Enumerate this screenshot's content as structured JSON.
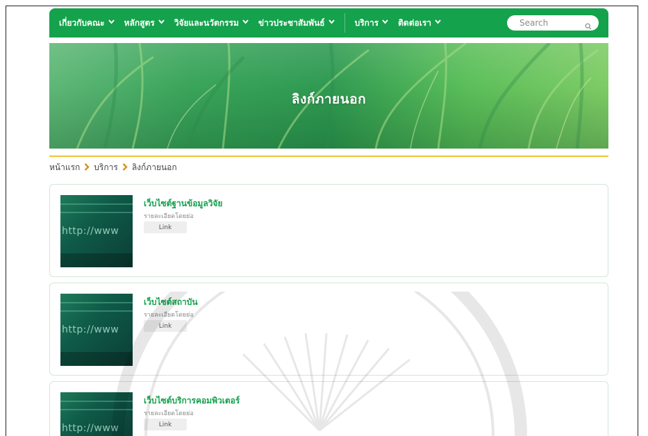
{
  "nav": {
    "items": [
      {
        "label": "เกี่ยวกับคณะ"
      },
      {
        "label": "หลักสูตร"
      },
      {
        "label": "วิจัยและนวัตกรรม"
      },
      {
        "label": "ข่าวประชาสัมพันธ์"
      },
      {
        "label": "บริการ"
      },
      {
        "label": "ติดต่อเรา"
      }
    ],
    "search_placeholder": "Search"
  },
  "banner": {
    "title": "ลิงก์ภายนอก"
  },
  "breadcrumb": {
    "items": [
      "หน้าแรก",
      "บริการ",
      "ลิงก์ภายนอก"
    ]
  },
  "links": [
    {
      "title": "เว็บไซต์ฐานข้อมูลวิจัย",
      "desc": "รายละเอียดโดยย่อ",
      "button": "Link",
      "thumb_text": "http://www"
    },
    {
      "title": "เว็บไซต์สถาบัน",
      "desc": "รายละเอียดโดยย่อ",
      "button": "Link",
      "thumb_text": "http://www"
    },
    {
      "title": "เว็บไซต์บริการคอมพิวเตอร์",
      "desc": "รายละเอียดโดยย่อ",
      "button": "Link",
      "thumb_text": "http://www"
    }
  ],
  "colors": {
    "brand_green": "#14a24c",
    "accent_gold": "#f1c232",
    "breadcrumb_chevron": "#d4941c"
  }
}
